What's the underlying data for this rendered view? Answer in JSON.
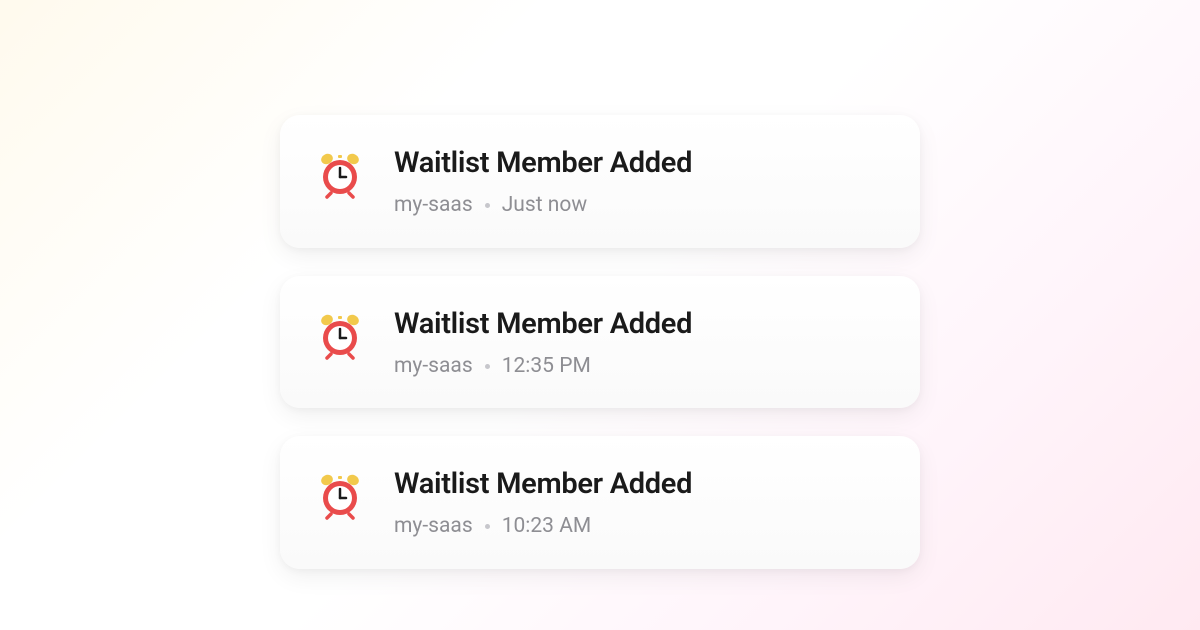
{
  "notifications": [
    {
      "icon": "alarm-clock-icon",
      "title": "Waitlist Member Added",
      "source": "my-saas",
      "timestamp": "Just now"
    },
    {
      "icon": "alarm-clock-icon",
      "title": "Waitlist Member Added",
      "source": "my-saas",
      "timestamp": "12:35 PM"
    },
    {
      "icon": "alarm-clock-icon",
      "title": "Waitlist Member Added",
      "source": "my-saas",
      "timestamp": "10:23 AM"
    }
  ]
}
